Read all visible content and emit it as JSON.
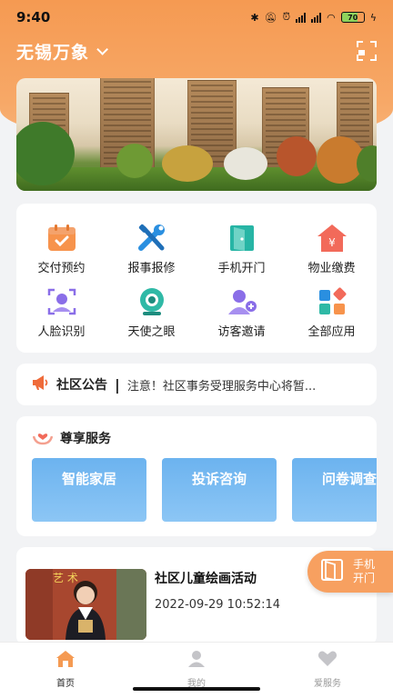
{
  "status_bar": {
    "time": "9:40",
    "battery": "70"
  },
  "header": {
    "city": "无锡万象",
    "scan_icon": "scan-icon"
  },
  "banner": {
    "description_icon": "community-photo"
  },
  "grid": {
    "items": [
      {
        "label": "交付预约",
        "icon": "calendar-check-icon",
        "color": "#f7934c"
      },
      {
        "label": "报事报修",
        "icon": "tools-icon",
        "color": "#2a8fe0"
      },
      {
        "label": "手机开门",
        "icon": "door-icon",
        "color": "#27b5a5"
      },
      {
        "label": "物业缴费",
        "icon": "house-yen-icon",
        "color": "#f26a5a"
      },
      {
        "label": "人脸识别",
        "icon": "face-scan-icon",
        "color": "#8a6ee8"
      },
      {
        "label": "天使之眼",
        "icon": "camera-eye-icon",
        "color": "#2fb9a6"
      },
      {
        "label": "访客邀请",
        "icon": "add-user-icon",
        "color": "#8a6ee8"
      },
      {
        "label": "全部应用",
        "icon": "apps-grid-icon",
        "color": "#f26a5a"
      }
    ]
  },
  "notice": {
    "title": "社区公告",
    "separator": "|",
    "text": "注意！社区事务受理服务中心将暂...",
    "icon": "megaphone-icon"
  },
  "premium": {
    "title": "尊享服务",
    "icon": "hands-heart-icon",
    "services": [
      "智能家居",
      "投诉咨询",
      "问卷调查"
    ]
  },
  "activity": {
    "title": "社区儿童绘画活动",
    "time": "2022-09-29 10:52:14"
  },
  "float_button": {
    "label": "手机开门",
    "icon": "door-icon"
  },
  "tabs": [
    {
      "label": "首页",
      "icon": "home-icon",
      "active": true
    },
    {
      "label": "我的",
      "icon": "user-icon",
      "active": false
    },
    {
      "label": "爱服务",
      "icon": "heart-icon",
      "active": false
    }
  ],
  "colors": {
    "accent": "#f59a52",
    "tile_blue": "#6cb3ef"
  }
}
